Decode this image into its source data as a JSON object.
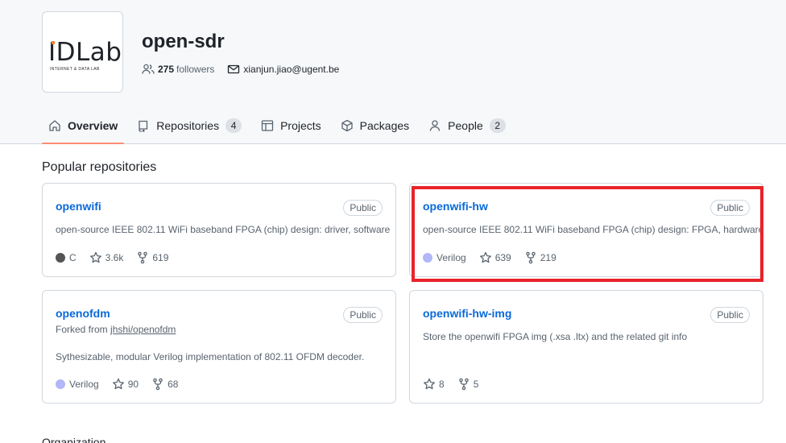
{
  "org": {
    "avatar_text": "IDLab",
    "avatar_subtext": "INTERNET & DATA LAB",
    "name": "open-sdr",
    "followers_count": "275",
    "followers_label": "followers",
    "email": "xianjun.jiao@ugent.be"
  },
  "tabs": [
    {
      "label": "Overview",
      "icon": "home-icon",
      "active": true
    },
    {
      "label": "Repositories",
      "icon": "repo-icon",
      "count": "4"
    },
    {
      "label": "Projects",
      "icon": "table-icon"
    },
    {
      "label": "Packages",
      "icon": "package-icon"
    },
    {
      "label": "People",
      "icon": "person-icon",
      "count": "2"
    }
  ],
  "section_title": "Popular repositories",
  "repos": [
    {
      "name": "openwifi",
      "visibility": "Public",
      "description": "open-source IEEE 802.11 WiFi baseband FPGA (chip) design: driver, software",
      "language": "C",
      "language_color": "#555555",
      "stars": "3.6k",
      "forks": "619"
    },
    {
      "name": "openwifi-hw",
      "visibility": "Public",
      "description": "open-source IEEE 802.11 WiFi baseband FPGA (chip) design: FPGA, hardware",
      "language": "Verilog",
      "language_color": "#b2b7f8",
      "stars": "639",
      "forks": "219"
    },
    {
      "name": "openofdm",
      "visibility": "Public",
      "forked_prefix": "Forked from",
      "forked_from": "jhshi/openofdm",
      "description": "Sythesizable, modular Verilog implementation of 802.11 OFDM decoder.",
      "language": "Verilog",
      "language_color": "#b2b7f8",
      "stars": "90",
      "forks": "68"
    },
    {
      "name": "openwifi-hw-img",
      "visibility": "Public",
      "description": "Store the openwifi FPGA img (.xsa .ltx) and the related git info",
      "stars": "8",
      "forks": "5"
    }
  ],
  "highlight_color": "#e8232b",
  "accent_color": "#fd8c73",
  "link_color": "#0969da",
  "next_section_partial": "Organization"
}
